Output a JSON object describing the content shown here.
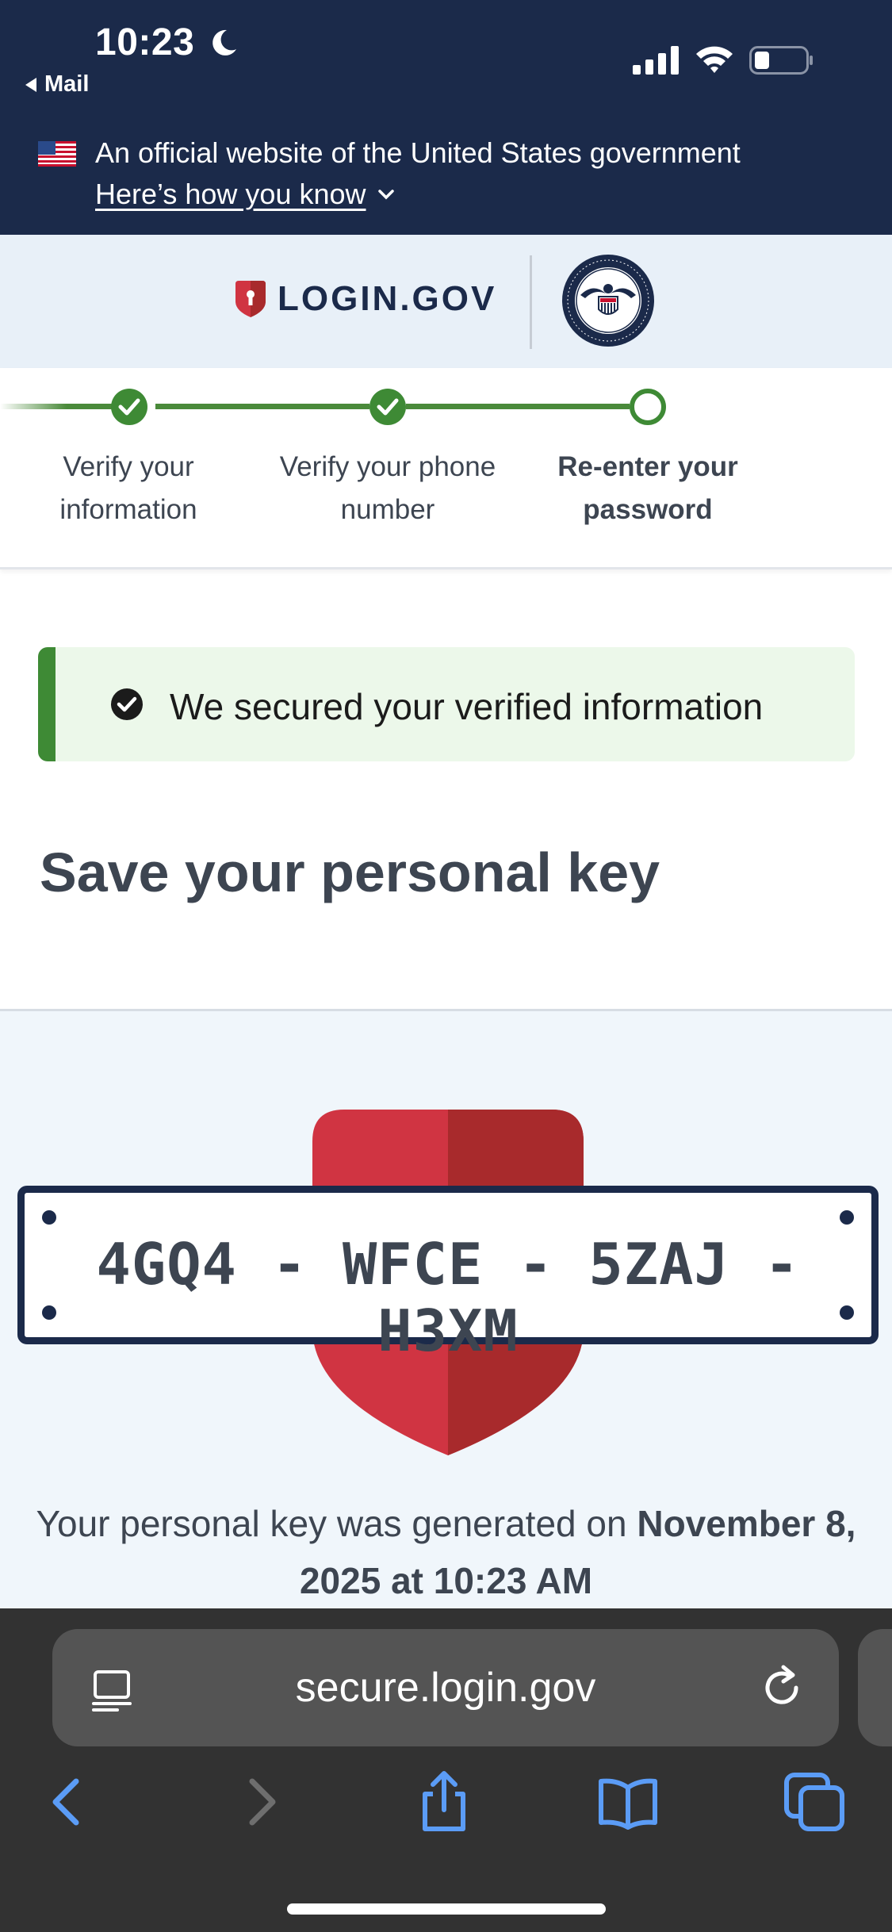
{
  "status_bar": {
    "time": "10:23",
    "back_label": "Mail"
  },
  "gov_banner": {
    "text": "An official website of the United States government",
    "link": "Here’s how you know"
  },
  "header": {
    "logo_text": "LOGIN.GOV",
    "partner_seal": "ssa-seal-icon"
  },
  "steps": [
    {
      "label_line1": "Verify your",
      "label_line2": "information",
      "state": "complete"
    },
    {
      "label_line1": "Verify your phone",
      "label_line2": "number",
      "state": "complete"
    },
    {
      "label_line1": "Re-enter your",
      "label_line2": "password",
      "state": "current"
    }
  ],
  "alert": {
    "text": "We secured your verified information",
    "type": "success"
  },
  "heading": "Save your personal key",
  "personal_key": {
    "segments": [
      "4GQ4",
      "WFCE",
      "5ZAJ",
      "H3XM"
    ],
    "code": "4GQ4 - WFCE - 5ZAJ - H3XM",
    "generated_prefix": "Your personal key was generated on ",
    "generated_date": "November 8, 2025 at 10:23 AM"
  },
  "browser": {
    "url": "secure.login.gov"
  },
  "colors": {
    "navy": "#1b2a4a",
    "success_green": "#3e8a35",
    "alert_bg": "#ecf8ea",
    "shield_red_light": "#d03442",
    "shield_red_dark": "#a82a2c"
  }
}
